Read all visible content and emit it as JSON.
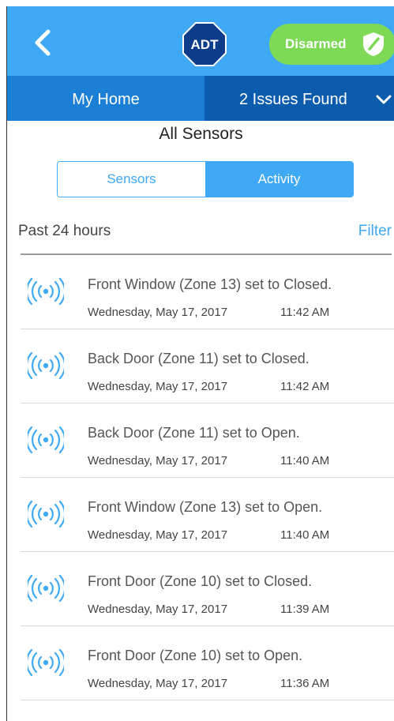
{
  "colors": {
    "topbar": "#3fa9f5",
    "subbar": "#1c7fd6",
    "subbar_active": "#0b5cad",
    "status_pill": "#7ed957",
    "accent": "#3fa9f5"
  },
  "header": {
    "back_icon": "chevron-left-icon",
    "logo_text": "ADT",
    "status_label": "Disarmed",
    "status_icon": "shield-icon"
  },
  "subnav": {
    "location": "My Home",
    "issues": "2 Issues Found",
    "issues_icon": "chevron-down-icon"
  },
  "page": {
    "title": "All Sensors",
    "tabs": [
      {
        "label": "Sensors",
        "selected": false
      },
      {
        "label": "Activity",
        "selected": true
      }
    ],
    "period": "Past 24 hours",
    "filter": "Filter"
  },
  "activity": [
    {
      "text": "Front Window (Zone 13) set to Closed.",
      "date": "Wednesday, May 17, 2017",
      "time": "11:42 AM",
      "icon": "sensor-signal-icon"
    },
    {
      "text": "Back Door (Zone 11) set to Closed.",
      "date": "Wednesday, May 17, 2017",
      "time": "11:42 AM",
      "icon": "sensor-signal-icon"
    },
    {
      "text": "Back Door (Zone 11) set to Open.",
      "date": "Wednesday, May 17, 2017",
      "time": "11:40 AM",
      "icon": "sensor-signal-icon"
    },
    {
      "text": "Front Window (Zone 13) set to Open.",
      "date": "Wednesday, May 17, 2017",
      "time": "11:40 AM",
      "icon": "sensor-signal-icon"
    },
    {
      "text": "Front Door (Zone 10) set to Closed.",
      "date": "Wednesday, May 17, 2017",
      "time": "11:39 AM",
      "icon": "sensor-signal-icon"
    },
    {
      "text": "Front Door (Zone 10) set to Open.",
      "date": "Wednesday, May 17, 2017",
      "time": "11:36 AM",
      "icon": "sensor-signal-icon"
    }
  ]
}
